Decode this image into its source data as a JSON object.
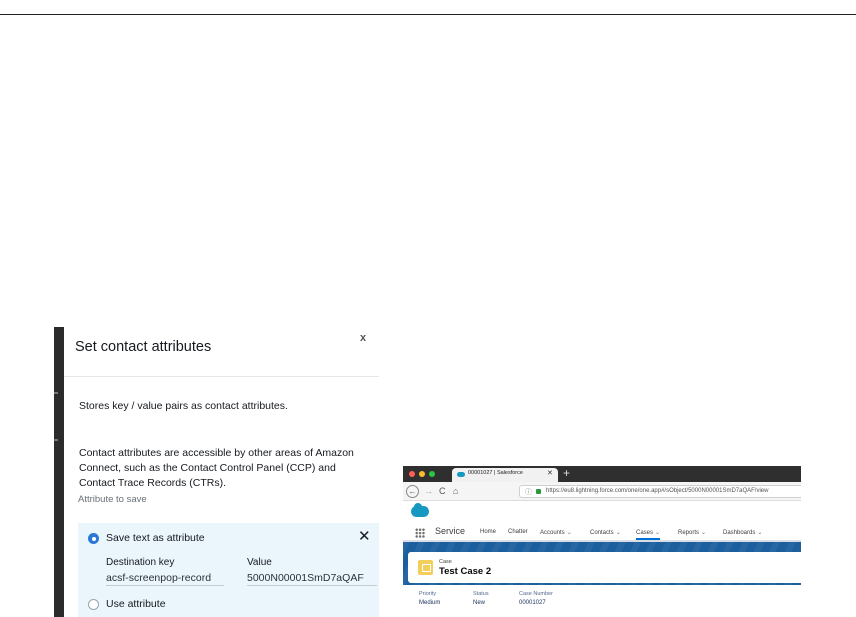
{
  "modal": {
    "title": "Set contact attributes",
    "close_glyph": "x",
    "description_1": "Stores key / value pairs as contact attributes.",
    "description_2": "Contact attributes are accessible by other areas of Amazon Connect, such as the Contact Control Panel (CCP) and Contact Trace Records (CTRs).",
    "section_label": "Attribute to save",
    "option_save_text": "Save text as attribute",
    "option_use_attribute": "Use attribute",
    "remove_glyph": "✕",
    "destination_key_label": "Destination key",
    "destination_key_value": "acsf-screenpop-record",
    "value_label": "Value",
    "value_value": "5000N00001SmD7aQAF"
  },
  "browser": {
    "tab_title": "00001027 | Salesforce",
    "tab_close": "✕",
    "new_tab": "+",
    "back_icon": "←",
    "forward_icon": "→",
    "reload_icon": "C",
    "home_icon": "⌂",
    "info_icon": "ⓘ",
    "url": "https://eu8.lightning.force.com/one/one.app#/sObject/5000N00001SmD7aQAF/view"
  },
  "salesforce": {
    "app_name": "Service",
    "nav": {
      "home": "Home",
      "chatter": "Chatter",
      "accounts": "Accounts",
      "contacts": "Contacts",
      "cases": "Cases",
      "reports": "Reports",
      "dashboards": "Dashboards"
    },
    "chevron": "⌄",
    "record": {
      "object_label": "Case",
      "title": "Test Case 2"
    },
    "fields": {
      "priority_label": "Priority",
      "priority_value": "Medium",
      "status_label": "Status",
      "status_value": "New",
      "case_number_label": "Case Number",
      "case_number_value": "00001027"
    }
  },
  "colors": {
    "selected_radio": "#2a78d6",
    "attribute_box_bg": "#eaf6fb",
    "salesforce_blue": "#1798c1",
    "header_band": "#1b5f9e",
    "case_icon": "#f2cf5b"
  }
}
